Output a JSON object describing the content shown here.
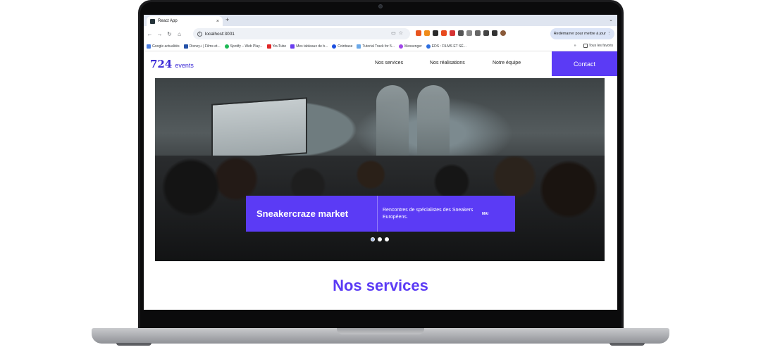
{
  "browser": {
    "tab_title": "React App",
    "tab_close": "×",
    "new_tab": "+",
    "address": "localhost:3001",
    "restart_label": "Redémarrer pour mettre à jour",
    "bookmarks": [
      {
        "label": "Google actualités",
        "color": "#4a7de0"
      },
      {
        "label": "Disney+ | Films et...",
        "color": "#2452a8"
      },
      {
        "label": "Spotify – Web Play...",
        "color": "#1db954"
      },
      {
        "label": "YouTube",
        "color": "#e02828"
      },
      {
        "label": "Mes tableaux de b...",
        "color": "#6a3df0"
      },
      {
        "label": "Coinbase",
        "color": "#1b4fe0"
      },
      {
        "label": "Tutorial Track for 5...",
        "color": "#6aa8e8"
      },
      {
        "label": "Messenger",
        "color": "#a046e8"
      },
      {
        "label": "EDS : FILMS ET SÉ...",
        "color": "#2d6ee0"
      }
    ],
    "bookmarks_more": "»",
    "all_bookmarks": "Tous les favoris"
  },
  "site": {
    "logo_number": "724",
    "logo_word": "events",
    "nav": {
      "services": "Nos services",
      "realisations": "Nos réalisations",
      "equipe": "Notre équipe",
      "contact": "Contact"
    },
    "hero": {
      "event_title": "Sneakercraze market",
      "event_description": "Rencontres de spécialistes des Sneakers Européens.",
      "event_month": "MAI",
      "slide_count": 3,
      "active_slide": 1
    },
    "section_title": "Nos services"
  },
  "colors": {
    "accent": "#5b3bf5",
    "logo": "#3b2ad6"
  }
}
